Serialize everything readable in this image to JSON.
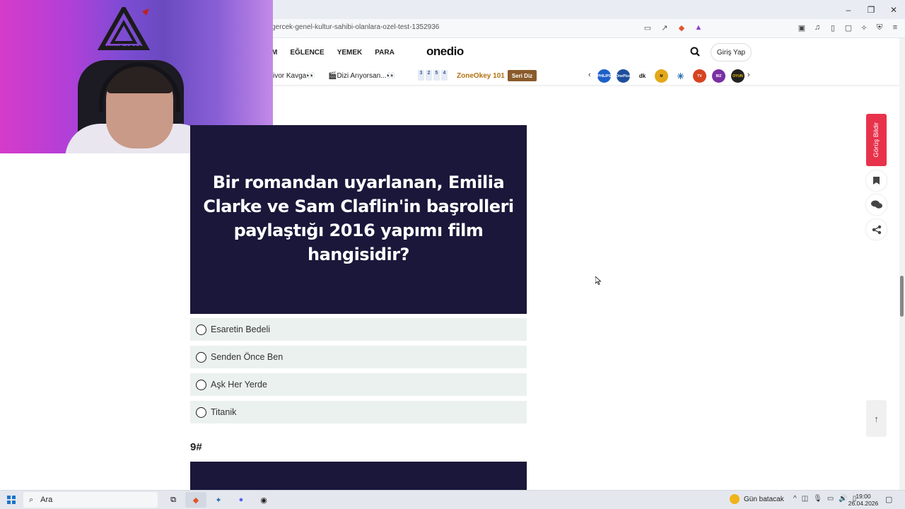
{
  "browser": {
    "url": "gercek-genel-kultur-sahibi-olanlara-ozel-test-1352936",
    "window_controls": [
      "–",
      "❐",
      "✕"
    ]
  },
  "site": {
    "nav": [
      "M",
      "EĞLENCE",
      "YEMEK",
      "PARA"
    ],
    "logo": "onedio",
    "login_label": "Giriş Yap"
  },
  "topics": {
    "item1": "ivor Kavga👀",
    "item2": "🎬Dizi Arıyorsan...👀",
    "zone_numbers": [
      "3",
      "2",
      "5",
      "4"
    ],
    "zone_label": "ZoneOkey 101",
    "seri_label": "Seri Diz",
    "badges": [
      {
        "label": "PHILIPS",
        "color": "#1c5fc9"
      },
      {
        "label": "OnePlus",
        "color": "#1d4f9c"
      },
      {
        "label": "dk",
        "color": "#ffffff"
      },
      {
        "label": "M",
        "color": "#e3a81a"
      },
      {
        "label": "✳",
        "color": "#ffffff"
      },
      {
        "label": "TV",
        "color": "#d64420"
      },
      {
        "label": "BIZ",
        "color": "#7a2fa3"
      },
      {
        "label": "OYUN",
        "color": "#222222"
      }
    ]
  },
  "webcam": {
    "logo_text": "AYKUT ARAS"
  },
  "quiz": {
    "question": "Bir romandan uyarlanan, Emilia Clarke ve Sam Claflin'in başrolleri paylaştığı 2016 yapımı film hangisidir?",
    "options": [
      "Esaretin Bedeli",
      "Senden Önce Ben",
      "Aşk Her Yerde",
      "Titanik"
    ],
    "next_number": "9#"
  },
  "side": {
    "feedback_label": "Görüş Bildir"
  },
  "taskbar": {
    "search_label": "Ara",
    "weather": "Gün batacak",
    "time": "19:00",
    "date": "26.04.2026"
  }
}
